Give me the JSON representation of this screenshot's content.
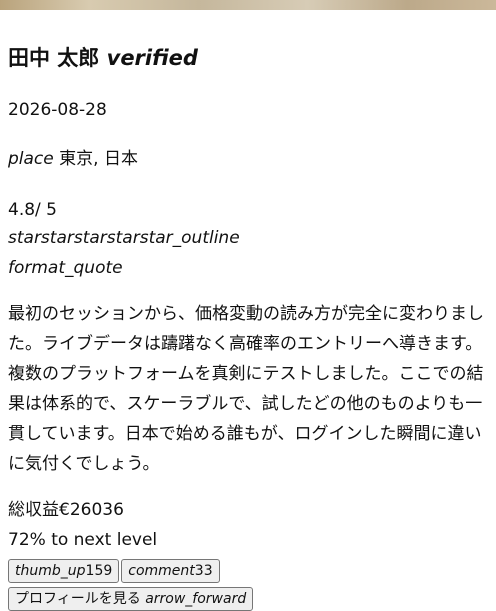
{
  "profile": {
    "name": "田中 太郎",
    "verified_icon": "verified",
    "date": "2026-08-28",
    "place_icon": "place",
    "location": "東京, 日本",
    "rating": "4.8/ 5",
    "stars": "starstarstarstarstar_outline",
    "quote_icon": "format_quote",
    "review": "最初のセッションから、価格変動の読み方が完全に変わりました。ライブデータは躊躇なく高確率のエントリーへ導きます。複数のプラットフォームを真剣にテストしました。ここでの結果は体系的で、スケーラブルで、試したどの他のものよりも一貫しています。日本で始める誰もが、ログインした瞬間に違いに気付くでしょう。",
    "earnings": "総収益€26036",
    "progress": "72% to next level"
  },
  "actions": {
    "like_icon": "thumb_up",
    "like_count": "159",
    "comment_icon": "comment",
    "comment_count": "33",
    "profile_label": "プロフィールを見る",
    "profile_icon": "arrow_forward"
  }
}
